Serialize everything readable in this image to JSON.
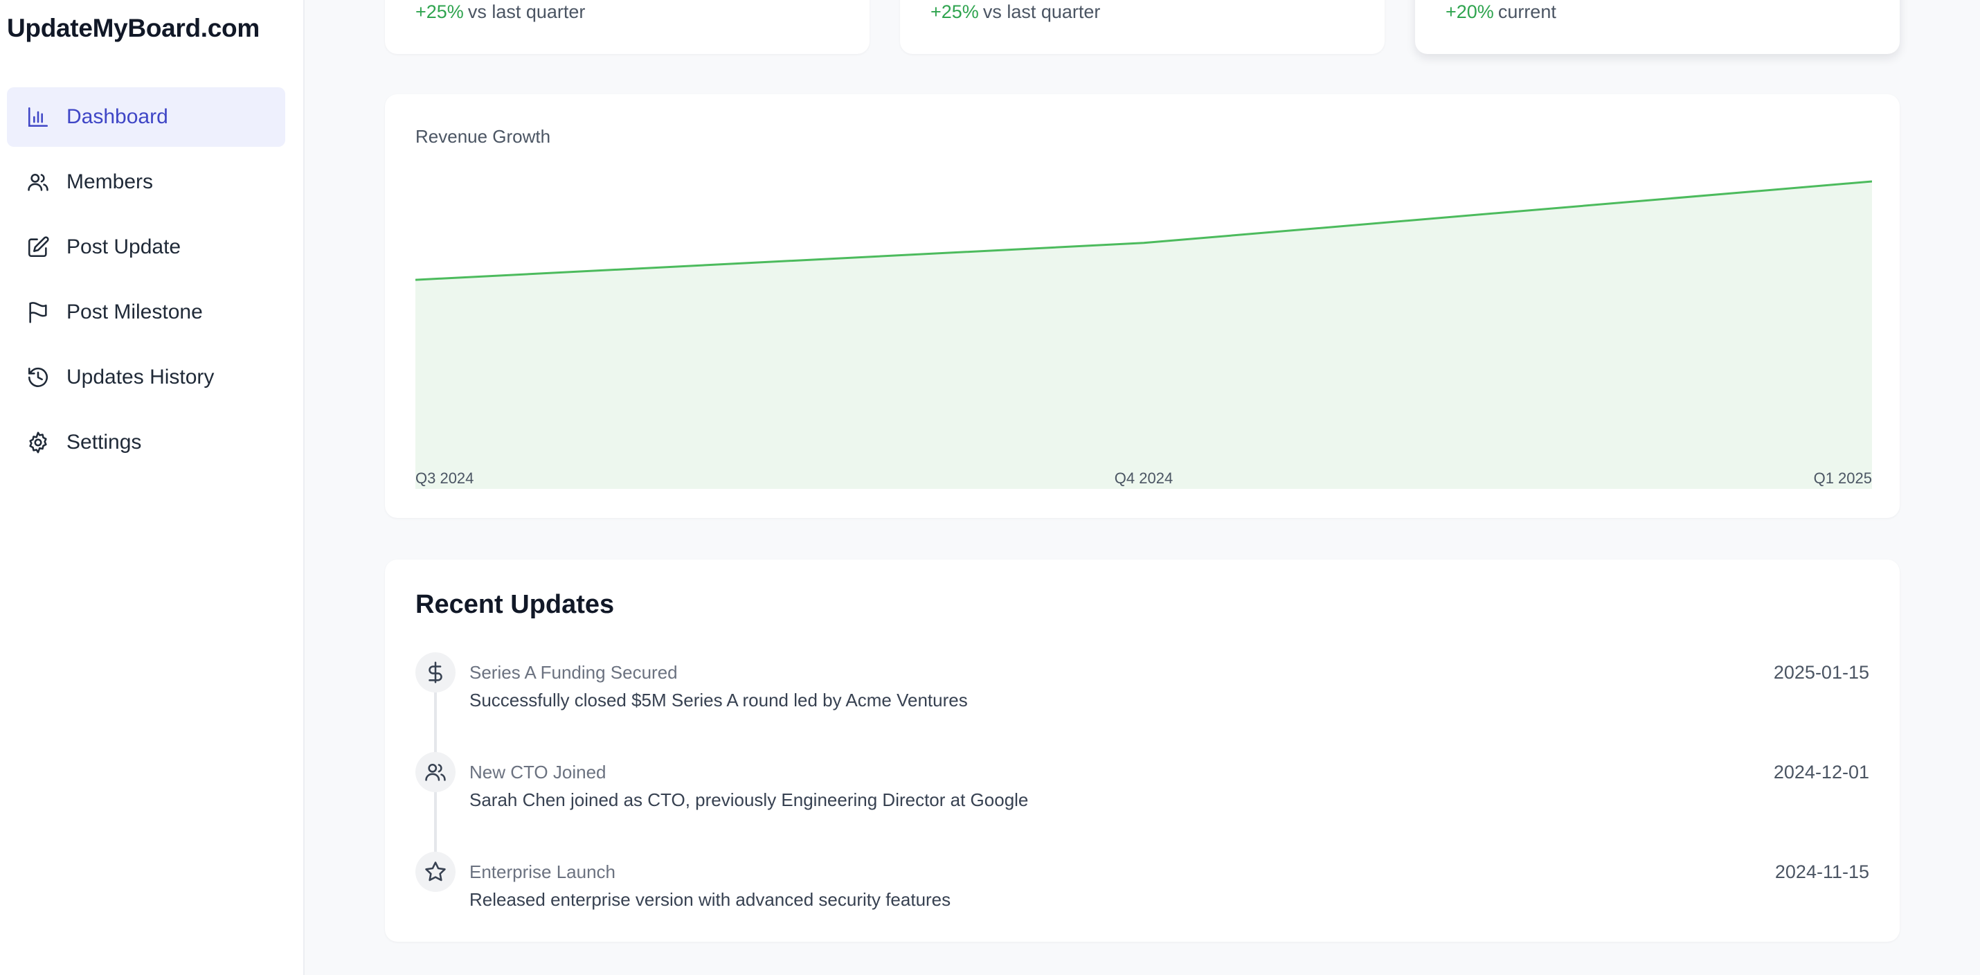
{
  "app": {
    "brand": "UpdateMyBoard.com"
  },
  "sidebar": {
    "items": [
      {
        "label": "Dashboard",
        "icon": "bar-chart-icon",
        "active": true
      },
      {
        "label": "Members",
        "icon": "users-icon"
      },
      {
        "label": "Post Update",
        "icon": "edit-icon"
      },
      {
        "label": "Post Milestone",
        "icon": "flag-icon"
      },
      {
        "label": "Updates History",
        "icon": "history-icon"
      },
      {
        "label": "Settings",
        "icon": "gear-icon"
      }
    ]
  },
  "stats": [
    {
      "delta": "+25%",
      "caption": "vs last quarter"
    },
    {
      "delta": "+25%",
      "caption": "vs last quarter"
    },
    {
      "delta": "+20%",
      "caption": "current"
    }
  ],
  "revenue_chart": {
    "title": "Revenue Growth"
  },
  "chart_data": {
    "type": "area",
    "title": "Revenue Growth",
    "categories": [
      "Q3 2024",
      "Q4 2024",
      "Q1 2025"
    ],
    "series": [
      {
        "values": [
          0.68,
          0.8,
          1.0
        ]
      }
    ],
    "ylim": [
      0,
      1.0
    ],
    "grid": false,
    "line_color": "#4cbb5d",
    "fill_color": "#edf7ee"
  },
  "recent_updates": {
    "title": "Recent Updates",
    "items": [
      {
        "icon": "dollar-icon",
        "title": "Series A Funding Secured",
        "description": "Successfully closed $5M Series A round led by Acme Ventures",
        "date": "2025-01-15"
      },
      {
        "icon": "users-icon",
        "title": "New CTO Joined",
        "description": "Sarah Chen joined as CTO, previously Engineering Director at Google",
        "date": "2024-12-01"
      },
      {
        "icon": "star-icon",
        "title": "Enterprise Launch",
        "description": "Released enterprise version with advanced security features",
        "date": "2024-11-15"
      }
    ]
  },
  "colors": {
    "accent": "#3f46c6",
    "accent_bg": "#eef0fd",
    "positive": "#2fa44f"
  }
}
